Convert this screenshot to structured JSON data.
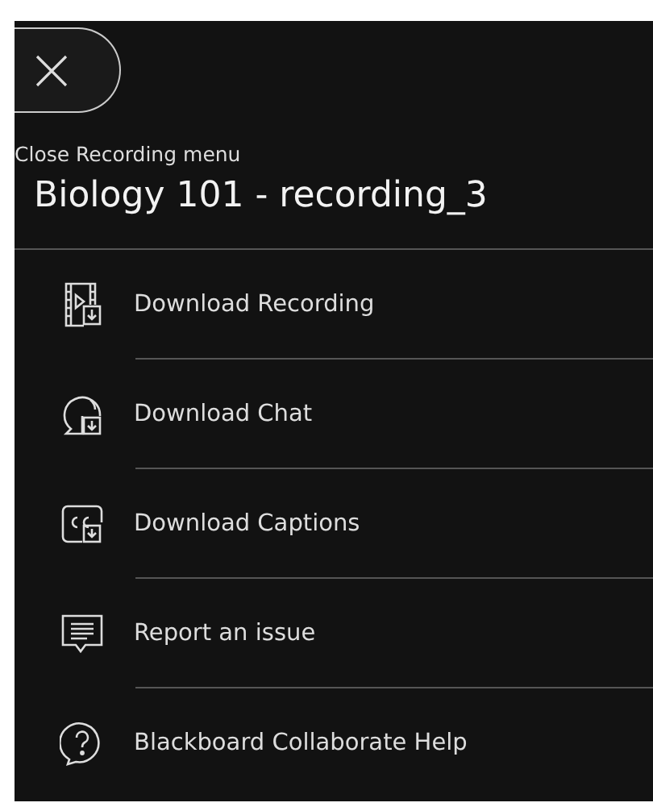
{
  "close_button": {
    "label": "Close Recording menu"
  },
  "title": "Biology 101 - recording_3",
  "menu_items": [
    {
      "kind": "recording",
      "label": "Download Recording"
    },
    {
      "kind": "chat",
      "label": "Download Chat"
    },
    {
      "kind": "captions",
      "label": "Download Captions"
    },
    {
      "kind": "report",
      "label": "Report an issue"
    },
    {
      "kind": "help",
      "label": "Blackboard Collaborate Help"
    }
  ]
}
